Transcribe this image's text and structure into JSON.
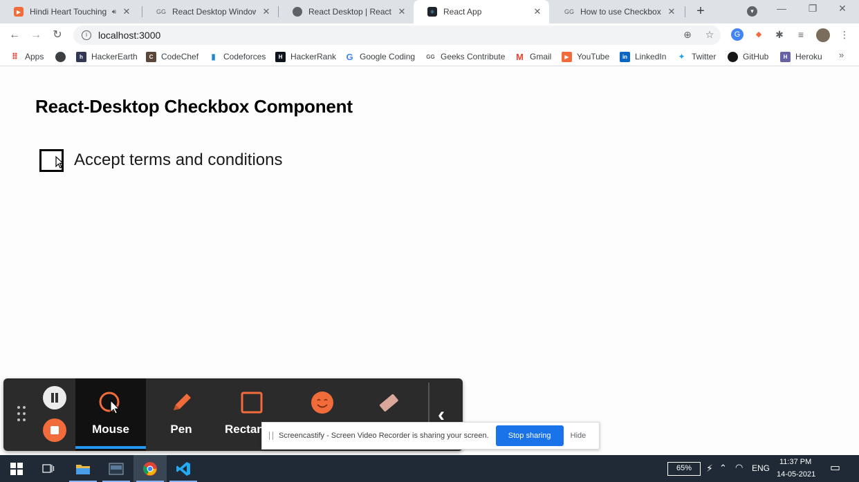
{
  "browser": {
    "tabs": [
      {
        "title": "Hindi Heart Touching",
        "favicon_color": "#f26b3a",
        "has_speaker": true
      },
      {
        "title": "React Desktop Windows C",
        "favicon_color": "#9aa0a6",
        "has_speaker": false
      },
      {
        "title": "React Desktop | React UI C",
        "favicon_color": "#5f6368",
        "has_speaker": false
      },
      {
        "title": "React App",
        "favicon_color": "#20232a",
        "has_speaker": false
      },
      {
        "title": "How to use Checkboxes i",
        "favicon_color": "#9aa0a6",
        "has_speaker": false
      }
    ],
    "active_tab_index": 3,
    "url": "localhost:3000"
  },
  "bookmarks": [
    {
      "label": "Apps",
      "icon": "apps-grid-icon",
      "color": "#ea4335"
    },
    {
      "label": "",
      "icon": "globe-icon",
      "color": "#3c4043"
    },
    {
      "label": "HackerEarth",
      "icon": "hackerearth-icon",
      "color": "#323754"
    },
    {
      "label": "CodeChef",
      "icon": "codechef-icon",
      "color": "#5b4638"
    },
    {
      "label": "Codeforces",
      "icon": "codeforces-icon",
      "color": "#1f8acb"
    },
    {
      "label": "HackerRank",
      "icon": "hackerrank-icon",
      "color": "#0e141e"
    },
    {
      "label": "Google Coding",
      "icon": "google-icon",
      "color": "#4285f4"
    },
    {
      "label": "Geeks Contribute",
      "icon": "gfg-icon",
      "color": "#9aa0a6"
    },
    {
      "label": "Gmail",
      "icon": "gmail-icon",
      "color": "#ea4335"
    },
    {
      "label": "YouTube",
      "icon": "youtube-icon",
      "color": "#f26b3a"
    },
    {
      "label": "LinkedIn",
      "icon": "linkedin-icon",
      "color": "#0a66c2"
    },
    {
      "label": "Twitter",
      "icon": "twitter-icon",
      "color": "#1da1f2"
    },
    {
      "label": "GitHub",
      "icon": "github-icon",
      "color": "#181717"
    },
    {
      "label": "Heroku",
      "icon": "heroku-icon",
      "color": "#6762a6"
    }
  ],
  "page": {
    "title": "React-Desktop Checkbox Component",
    "checkbox_label": "Accept terms and conditions",
    "checkbox_checked": false
  },
  "screencastify": {
    "tools": [
      {
        "label": "Mouse",
        "icon": "mouse-cursor-icon",
        "active": true
      },
      {
        "label": "Pen",
        "icon": "pen-icon",
        "active": false
      },
      {
        "label": "Rectan",
        "icon": "rectangle-icon",
        "active": false
      },
      {
        "label": "",
        "icon": "sticker-face-icon",
        "active": false
      },
      {
        "label": "",
        "icon": "eraser-icon",
        "active": false
      }
    ],
    "accent": "#f26b3a"
  },
  "share_bar": {
    "message": "Screencastify - Screen Video Recorder is sharing your screen.",
    "stop_label": "Stop sharing",
    "hide_label": "Hide"
  },
  "taskbar": {
    "battery": "65%",
    "language": "ENG",
    "time": "11:37 PM",
    "date": "14-05-2021"
  }
}
